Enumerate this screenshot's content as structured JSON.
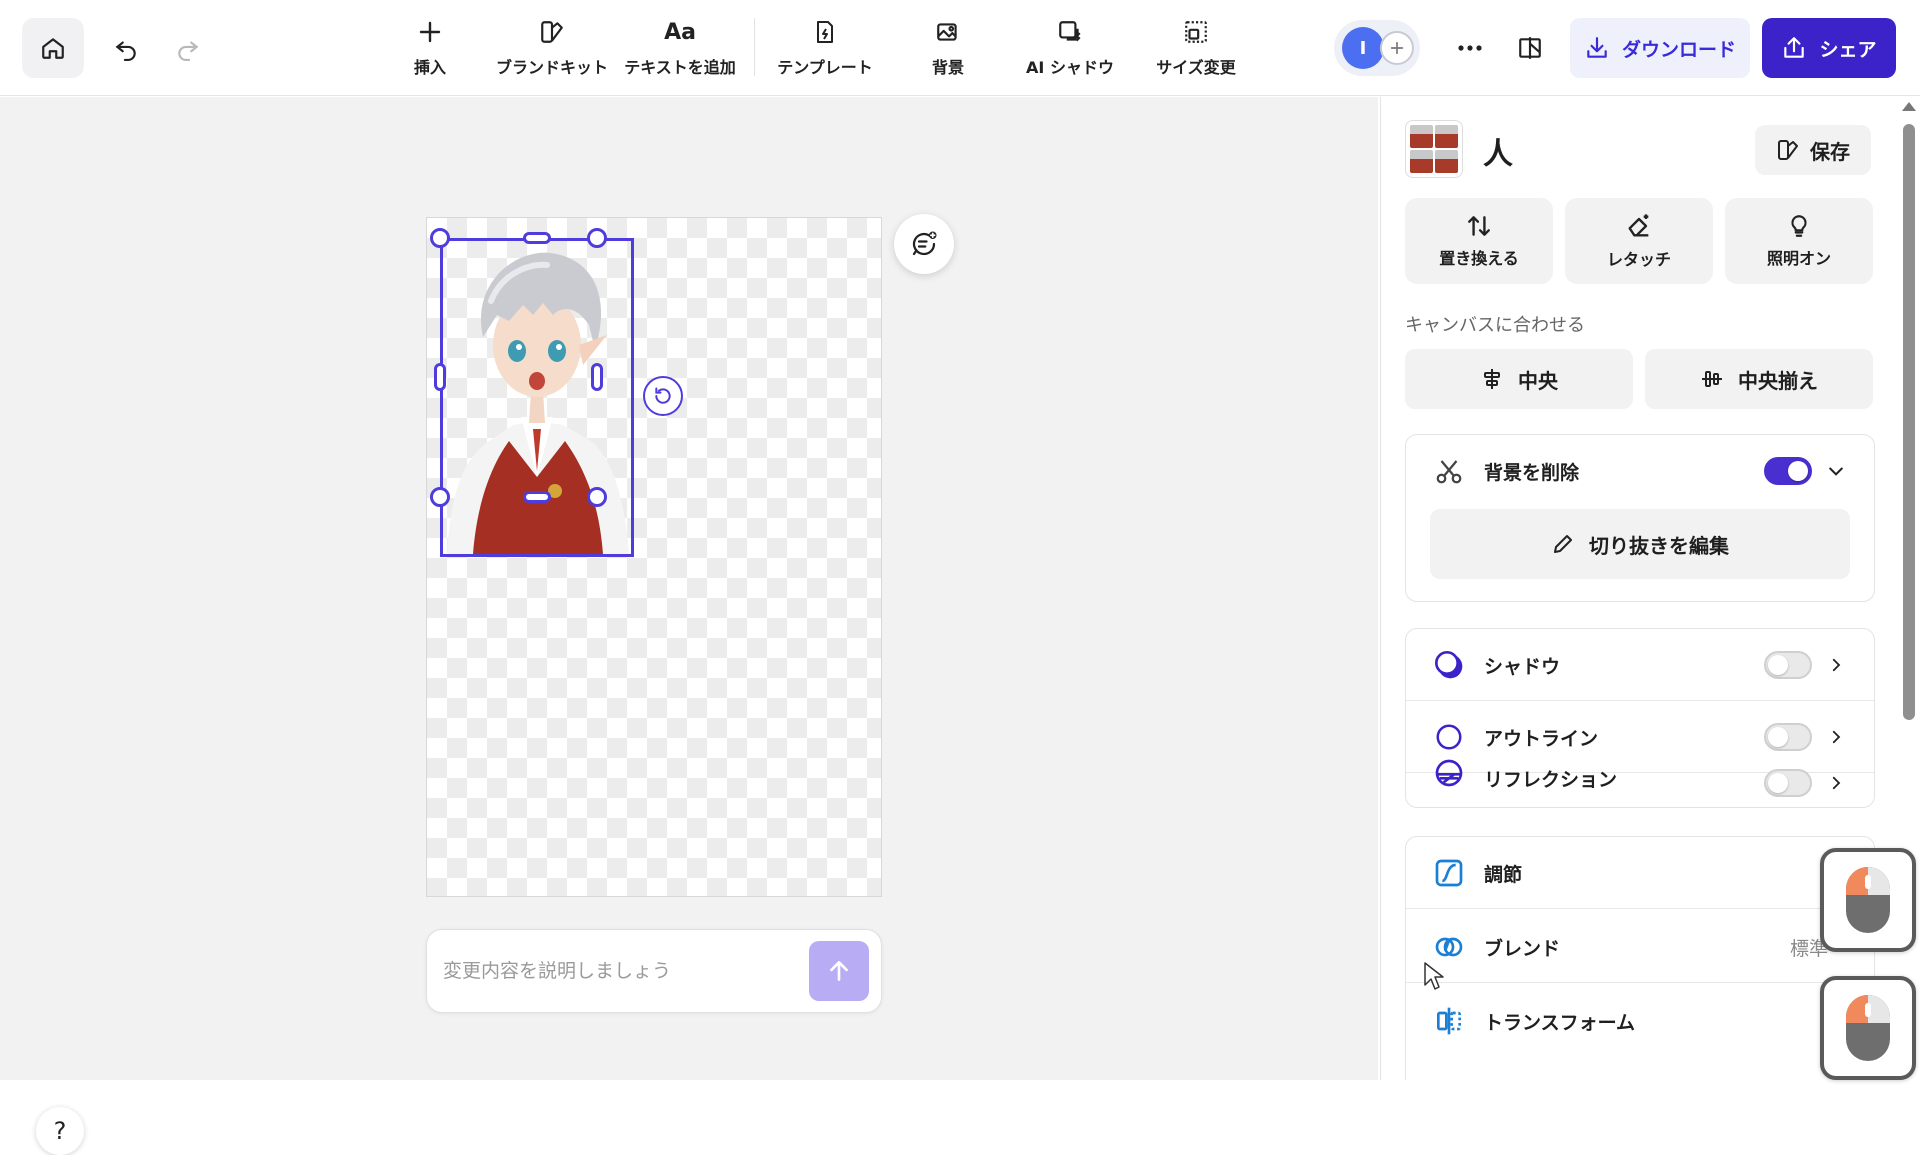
{
  "toolbar": {
    "tools": [
      {
        "label": "挿入",
        "icon": "plus-icon"
      },
      {
        "label": "ブランドキット",
        "icon": "brand-kit-icon"
      },
      {
        "label": "テキストを追加",
        "icon": "text-icon"
      },
      {
        "label": "テンプレート",
        "icon": "template-icon"
      },
      {
        "label": "背景",
        "icon": "background-icon"
      },
      {
        "label": "AI シャドウ",
        "icon": "ai-shadow-icon"
      },
      {
        "label": "サイズ変更",
        "icon": "resize-icon"
      }
    ],
    "text_icon_glyph": "Aa",
    "avatar_initial": "I",
    "download_label": "ダウンロード",
    "share_label": "シェア"
  },
  "canvas": {
    "prompt_placeholder": "変更内容を説明しましょう",
    "help_label": "?"
  },
  "panel": {
    "layer_name": "人",
    "save_label": "保存",
    "actions": [
      {
        "label": "置き換える",
        "icon": "swap-icon"
      },
      {
        "label": "レタッチ",
        "icon": "eraser-icon"
      },
      {
        "label": "照明オン",
        "icon": "lightbulb-icon"
      }
    ],
    "fit_section_label": "キャンバスに合わせる",
    "fit_buttons": [
      {
        "label": "中央",
        "icon": "align-center-icon"
      },
      {
        "label": "中央揃え",
        "icon": "align-middle-icon"
      }
    ],
    "remove_bg": {
      "label": "背景を削除",
      "enabled": true,
      "edit_cutout_label": "切り抜きを編集"
    },
    "effects": [
      {
        "label": "シャドウ",
        "enabled": false
      },
      {
        "label": "アウトライン",
        "enabled": false
      },
      {
        "label": "リフレクション",
        "enabled": false
      }
    ],
    "settings": [
      {
        "label": "調節"
      },
      {
        "label": "ブレンド",
        "value": "標準"
      },
      {
        "label": "トランスフォーム"
      }
    ]
  },
  "colors": {
    "accent": "#3b23c9",
    "selection": "#4e3ddc",
    "avatar": "#4b6ff0"
  }
}
